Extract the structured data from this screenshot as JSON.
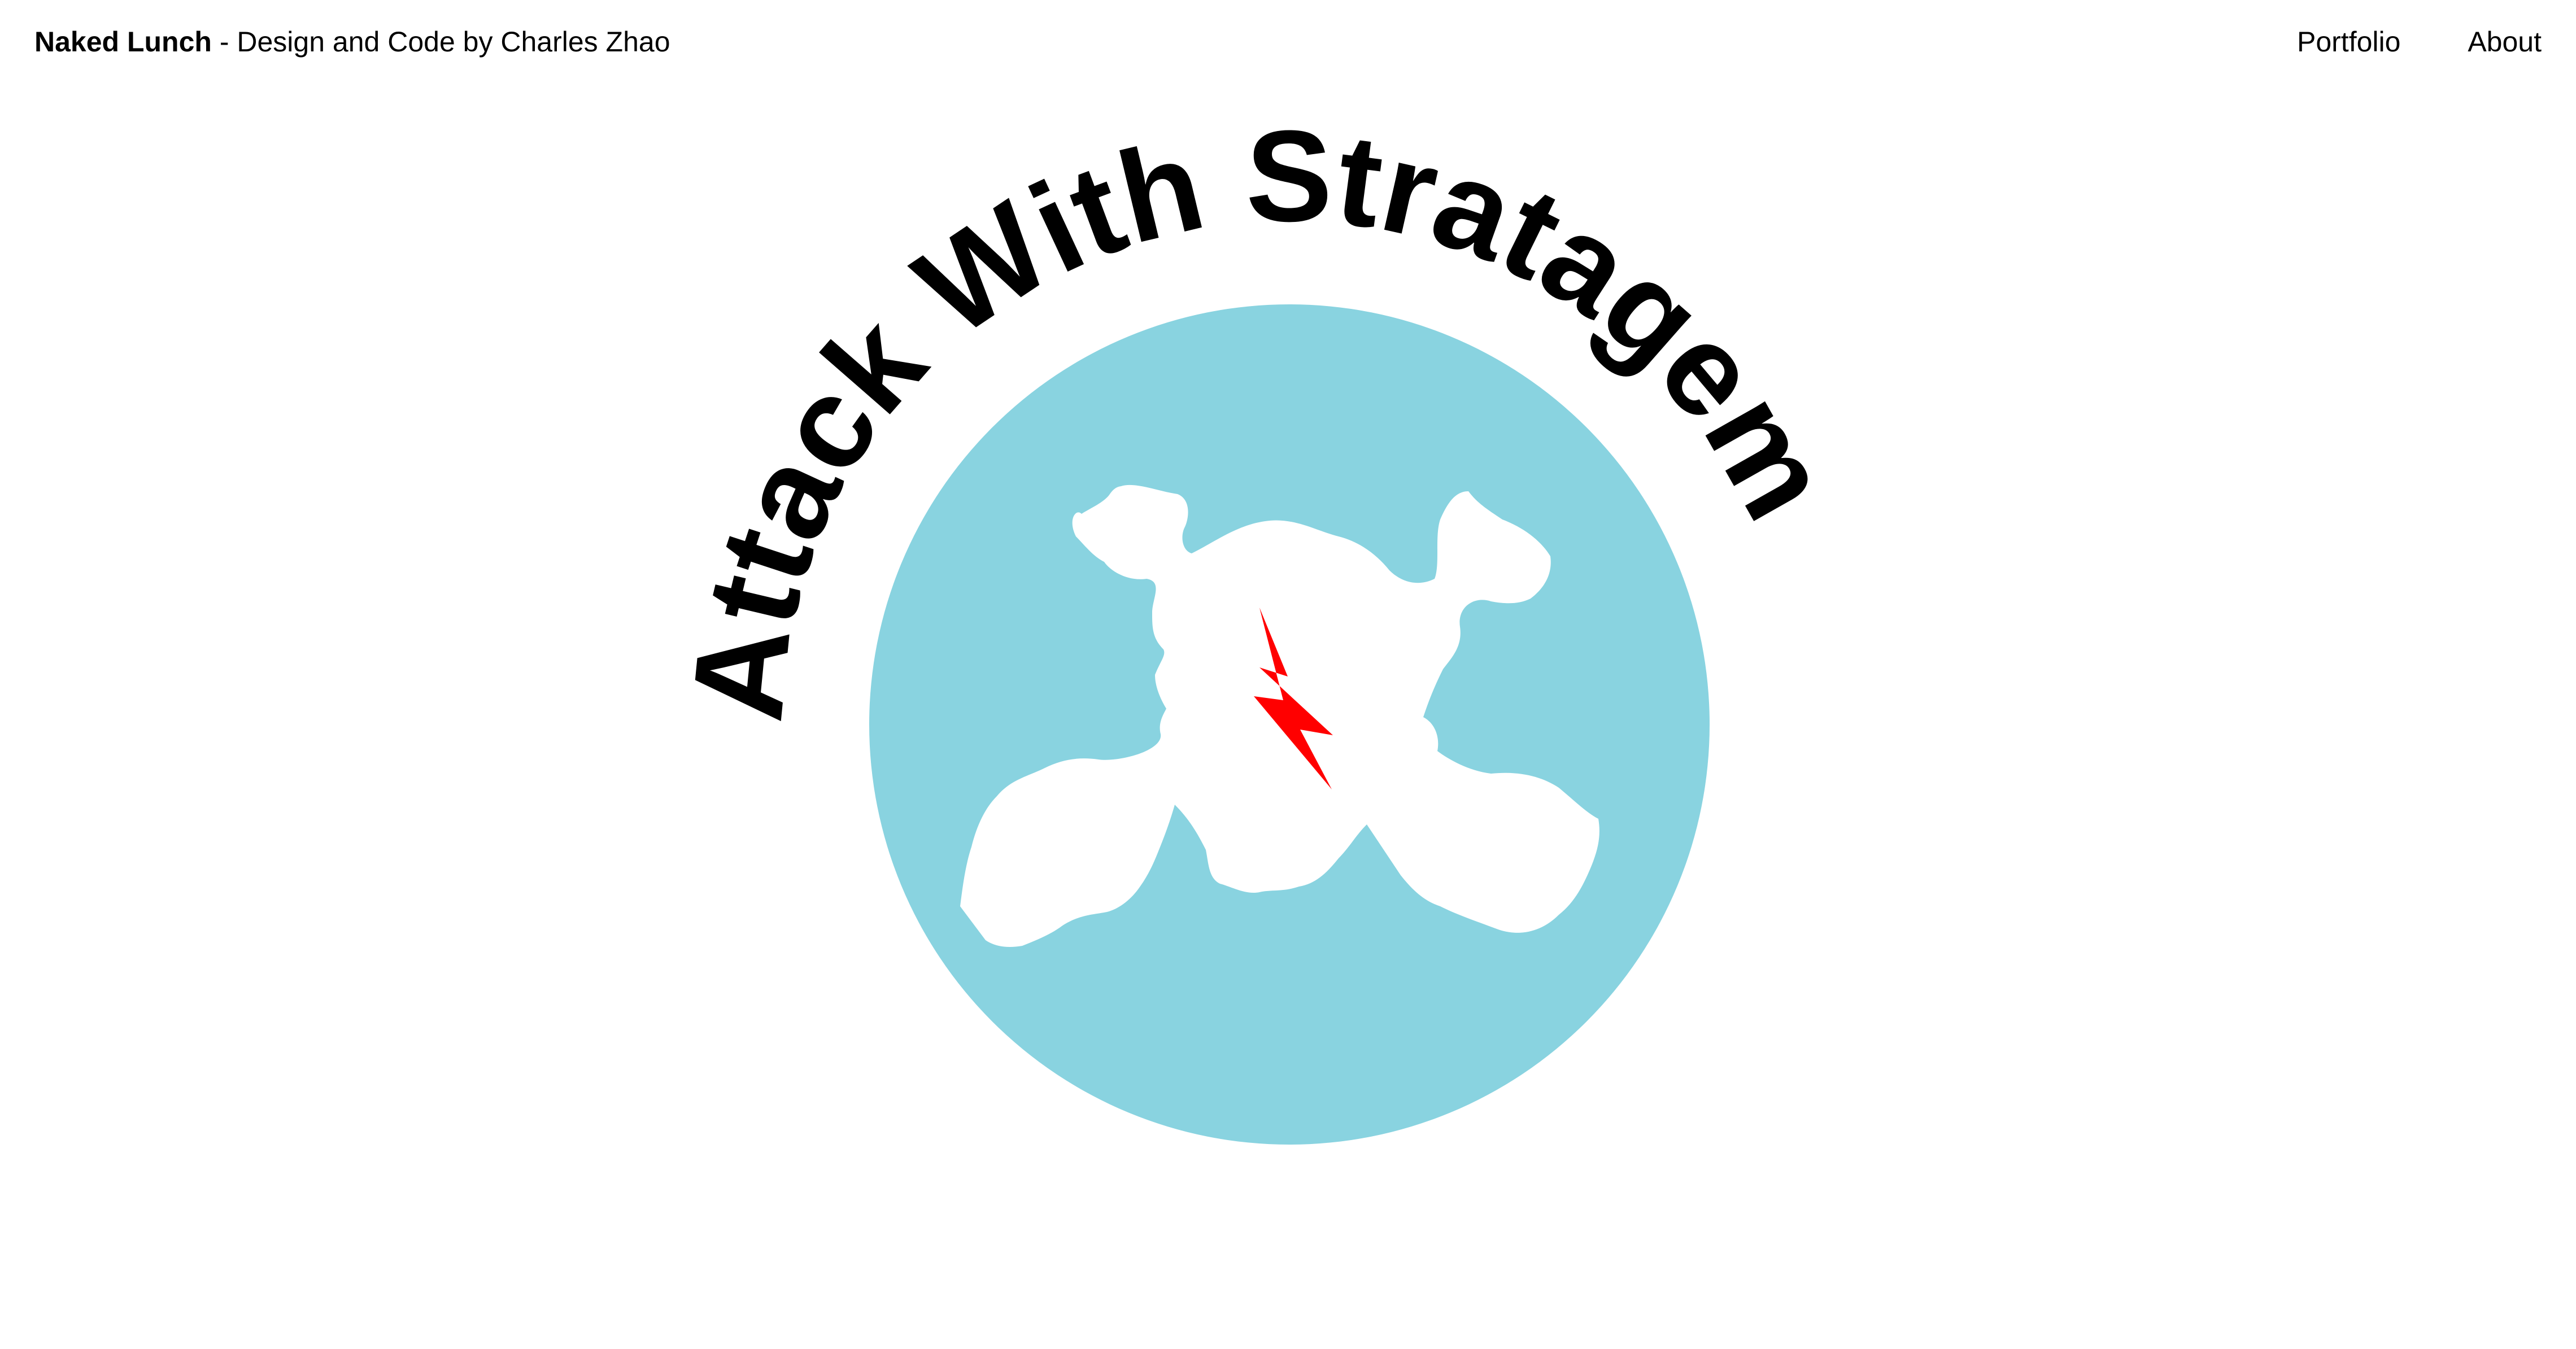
{
  "header": {
    "brand_name": "Naked Lunch",
    "brand_tagline": " - Design and Code by Charles Zhao",
    "nav": {
      "portfolio": "Portfolio",
      "about": "About"
    }
  },
  "hero": {
    "title": "Attack With Stratagem",
    "logo": {
      "circle_color": "#89D3E0",
      "skull_color": "#FFFFFF",
      "bolt_color": "#FF0000",
      "skull_icon": "skull-crossbones-icon",
      "bolt_icon": "lightning-bolt-icon"
    }
  }
}
